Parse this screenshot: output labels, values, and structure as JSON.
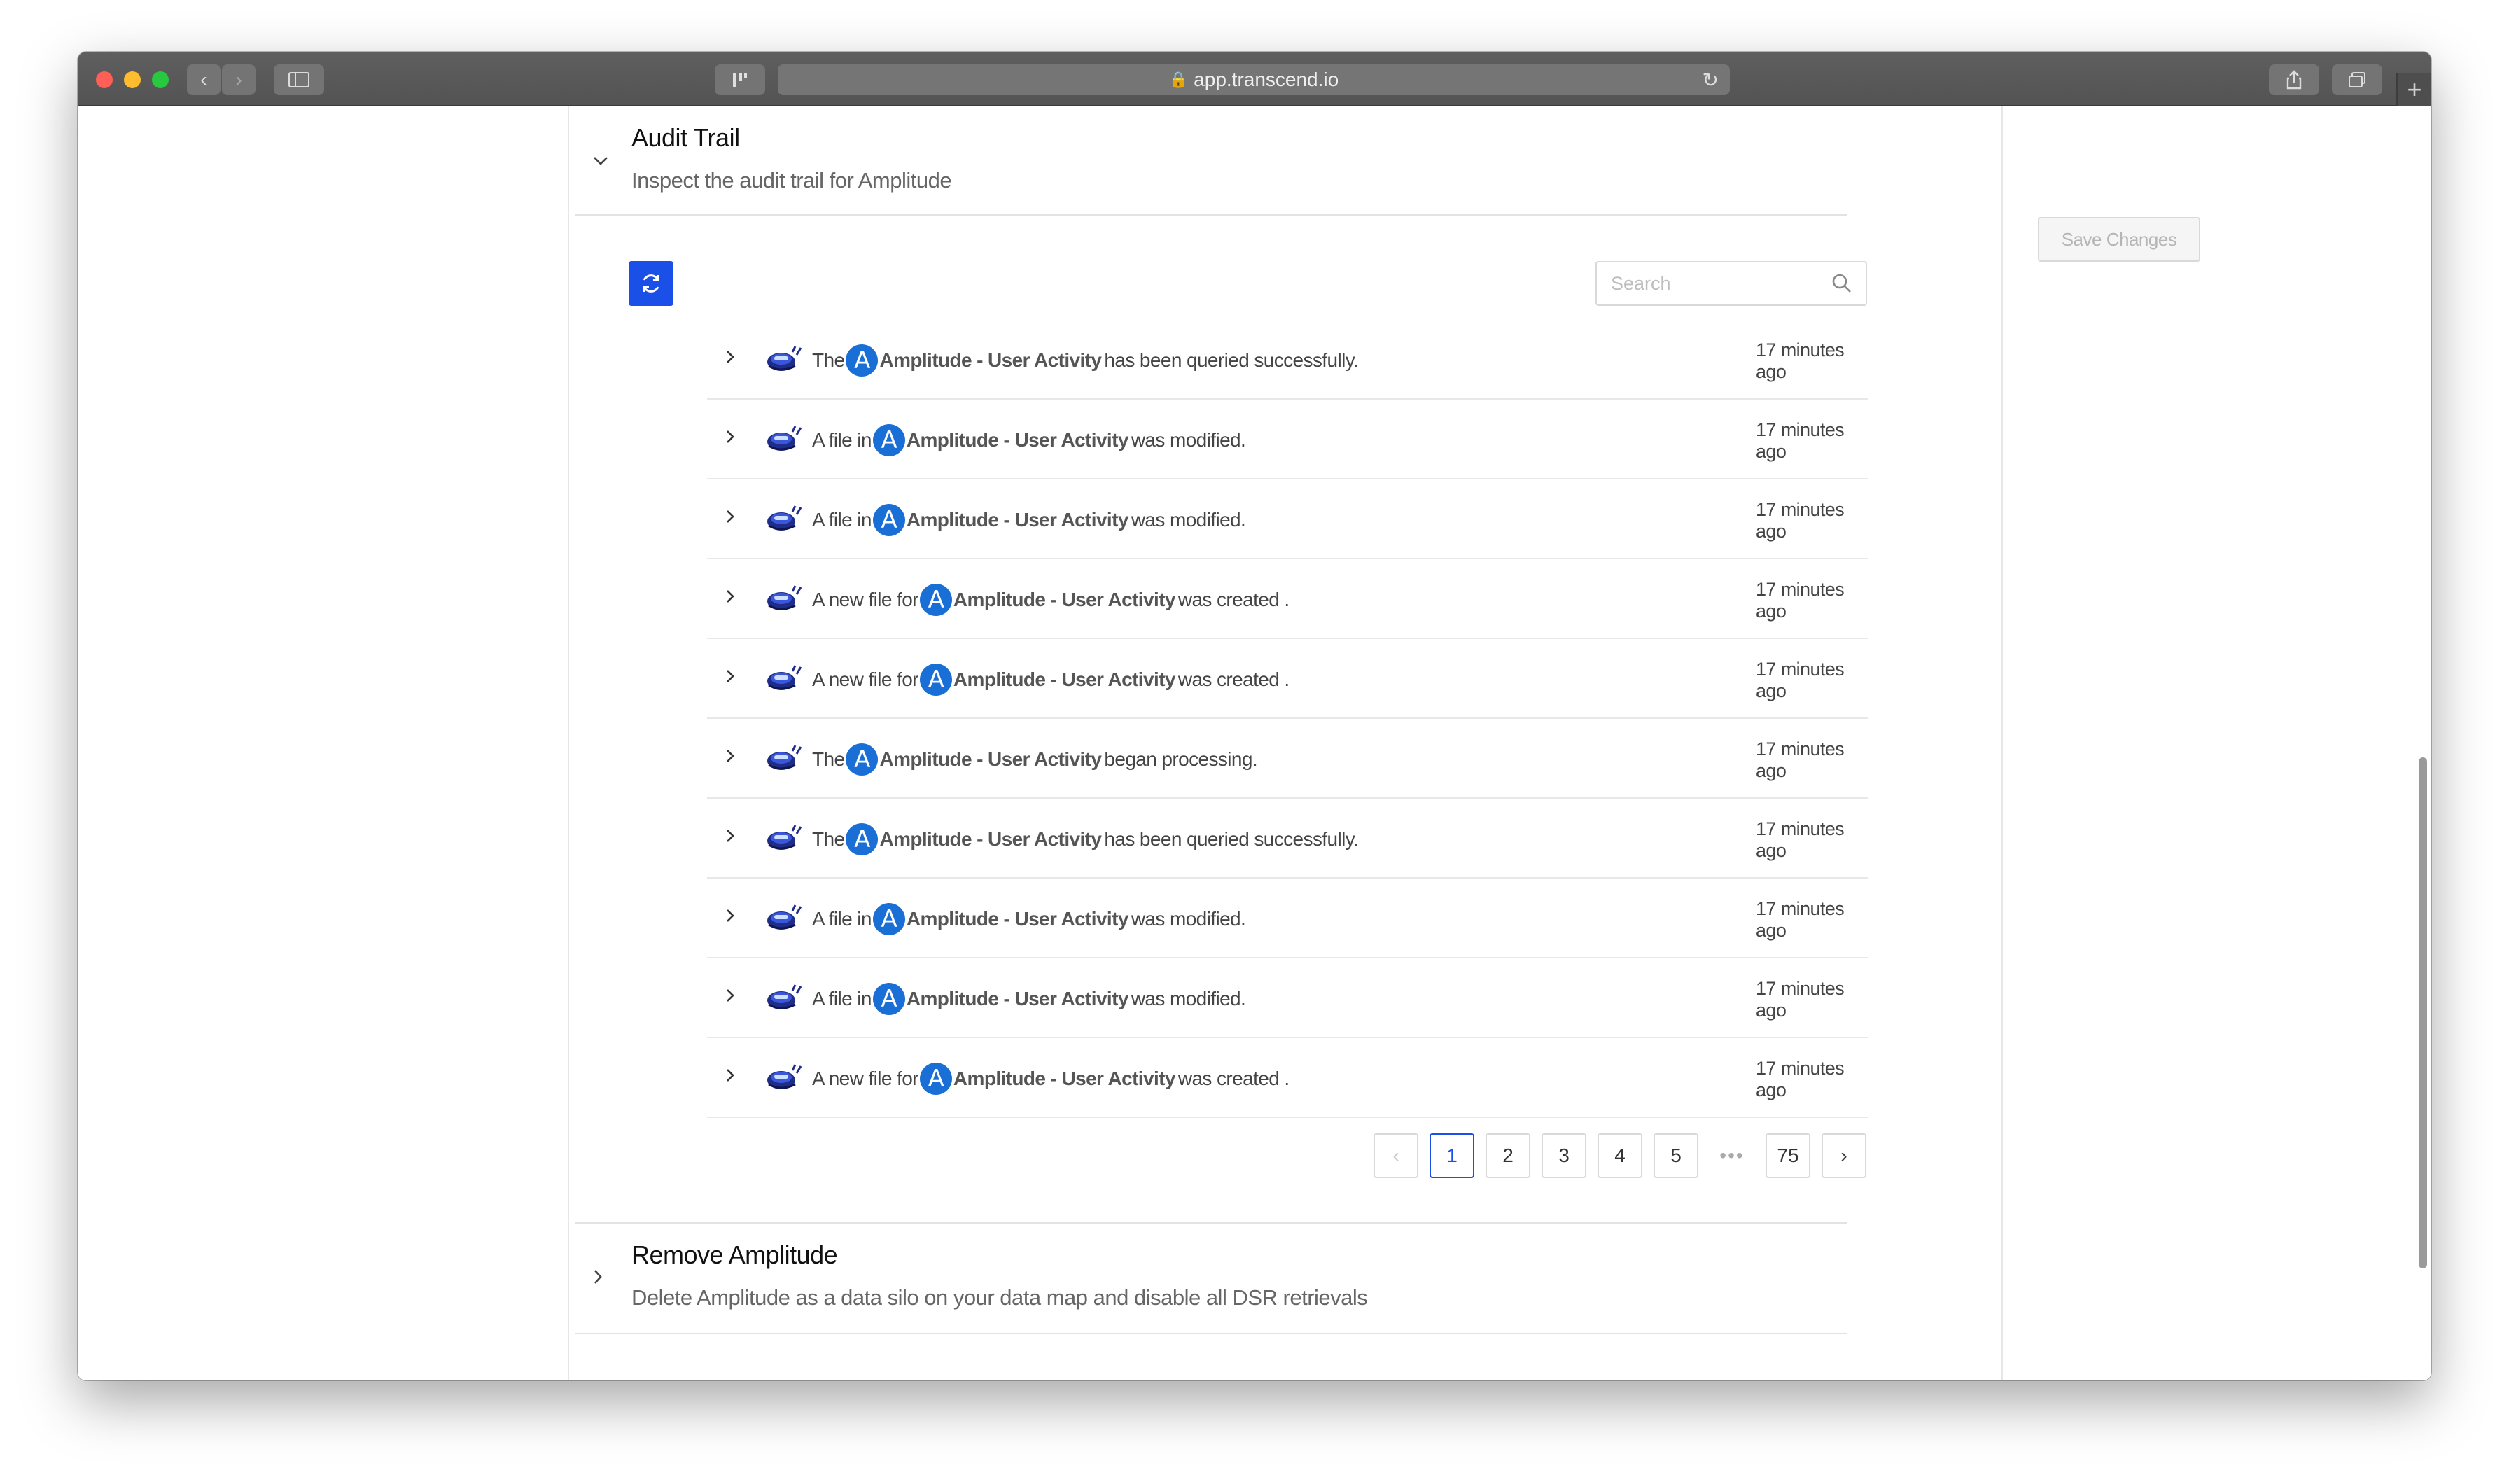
{
  "browser": {
    "url": "app.transcend.io",
    "back_icon": "‹",
    "forward_icon": "›",
    "reload_icon": "↻",
    "new_tab_icon": "+"
  },
  "toolbar": {
    "save_label": "Save Changes"
  },
  "audit_trail": {
    "title": "Audit Trail",
    "description": "Inspect the audit trail for Amplitude",
    "search_placeholder": "Search",
    "rows": [
      {
        "prefix": "The",
        "silo": "Amplitude - User Activity",
        "suffix": "has been queried successfully.",
        "time": "17 minutes ago"
      },
      {
        "prefix": "A file in",
        "silo": "Amplitude - User Activity",
        "suffix": "was modified.",
        "time": "17 minutes ago"
      },
      {
        "prefix": "A file in",
        "silo": "Amplitude - User Activity",
        "suffix": "was modified.",
        "time": "17 minutes ago"
      },
      {
        "prefix": "A new file for",
        "silo": "Amplitude - User Activity",
        "suffix": "was created .",
        "time": "17 minutes ago"
      },
      {
        "prefix": "A new file for",
        "silo": "Amplitude - User Activity",
        "suffix": "was created .",
        "time": "17 minutes ago"
      },
      {
        "prefix": "The",
        "silo": "Amplitude - User Activity",
        "suffix": "began processing.",
        "time": "17 minutes ago"
      },
      {
        "prefix": "The",
        "silo": "Amplitude - User Activity",
        "suffix": "has been queried successfully.",
        "time": "17 minutes ago"
      },
      {
        "prefix": "A file in",
        "silo": "Amplitude - User Activity",
        "suffix": "was modified.",
        "time": "17 minutes ago"
      },
      {
        "prefix": "A file in",
        "silo": "Amplitude - User Activity",
        "suffix": "was modified.",
        "time": "17 minutes ago"
      },
      {
        "prefix": "A new file for",
        "silo": "Amplitude - User Activity",
        "suffix": "was created .",
        "time": "17 minutes ago"
      }
    ],
    "pagination": {
      "prev": "‹",
      "pages": [
        "1",
        "2",
        "3",
        "4",
        "5"
      ],
      "ellipsis": "•••",
      "last": "75",
      "next": "›",
      "current": "1"
    }
  },
  "remove_section": {
    "title": "Remove Amplitude",
    "description": "Delete Amplitude as a data silo on your data map and disable all DSR retrievals"
  },
  "colors": {
    "accent": "#1a4fe8",
    "amplitude_logo": "#1a6fd6"
  }
}
